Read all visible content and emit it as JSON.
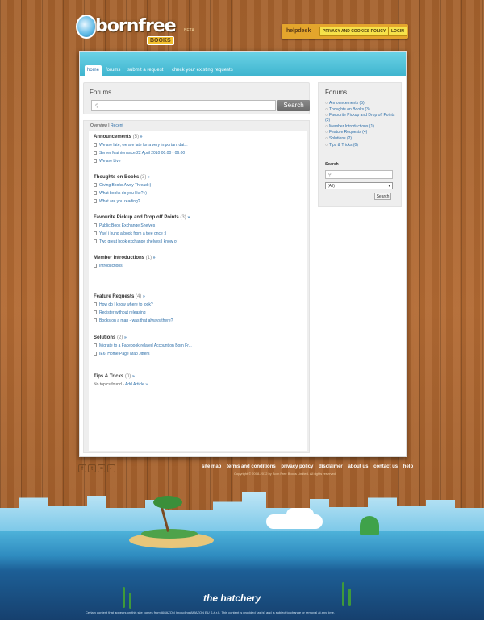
{
  "header": {
    "logo_word": "bornfree",
    "logo_books": "BOOKS",
    "logo_beta": "BETA",
    "helpdesk": "helpdesk",
    "privacy_button": "PRIVACY AND COOKIES POLICY",
    "login_button": "LOGIN"
  },
  "nav": {
    "tabs": [
      "home",
      "forums",
      "submit a request",
      "check your existing requests"
    ]
  },
  "search": {
    "title": "Forums",
    "button": "Search"
  },
  "subtabs": {
    "overview": "Overview",
    "separator": "|",
    "recent": "Recent"
  },
  "categories": [
    {
      "name": "Announcements",
      "count": "(5)",
      "items": [
        "We are late, we are late for a very important dat...",
        "Server Maintenance 22 April 2010 00:00 - 06:00",
        "We are Live"
      ]
    },
    {
      "name": "Thoughts on Books",
      "count": "(3)",
      "items": [
        "Giving Books Away Thread :)",
        "What books do you like? :)",
        "What are you reading?"
      ]
    },
    {
      "name": "Favourite Pickup and Drop off Points",
      "count": "(3)",
      "items": [
        "Public Book Exchange Shelves",
        "Yay! i hung a book from a tree once :)",
        "Two great book exchange shelves I know of"
      ]
    },
    {
      "name": "Member Introductions",
      "count": "(1)",
      "items": [
        "Introductions"
      ]
    },
    {
      "name": "Feature Requests",
      "count": "(4)",
      "items": [
        "How do I know where to look?",
        "Register without releasing",
        "Books on a map - was that always there?"
      ]
    },
    {
      "name": "Solutions",
      "count": "(2)",
      "items": [
        "Migrate to a Facebook-related Account on Born Fr...",
        "IE6: Home Page Map Jitters"
      ]
    },
    {
      "name": "Tips & Tricks",
      "count": "(0)",
      "items": []
    }
  ],
  "no_topics": {
    "text": "No topics found -",
    "link": "Add Article »"
  },
  "sidebar": {
    "title": "Forums",
    "items": [
      "Announcements (5)",
      "Thoughts on Books (3)",
      "Favourite Pickup and Drop off Points (3)",
      "Member Introductions (1)",
      "Feature Requests (4)",
      "Solutions (2)",
      "Tips & Tricks (0)"
    ],
    "search_label": "Search",
    "select_value": "(All)",
    "search_button": "Search"
  },
  "footer": {
    "links": [
      "site map",
      "terms and conditions",
      "privacy policy",
      "disclaimer",
      "about us",
      "contact us",
      "help"
    ],
    "copyright": "Copyright © 2008-2012 by Born Free Books Limited. All rights reserved.",
    "hatchery": "the hatchery",
    "disclaimer": "Certain content that appears on this site comes from AMAZON (including AMAZON EU S.à.r.l). This content is provided \"as is\" and is subject to change or removal at any time."
  },
  "icons": [
    "search-icon",
    "facebook-icon",
    "twitter-icon",
    "rss-icon",
    "delicious-icon",
    "document-icon"
  ]
}
